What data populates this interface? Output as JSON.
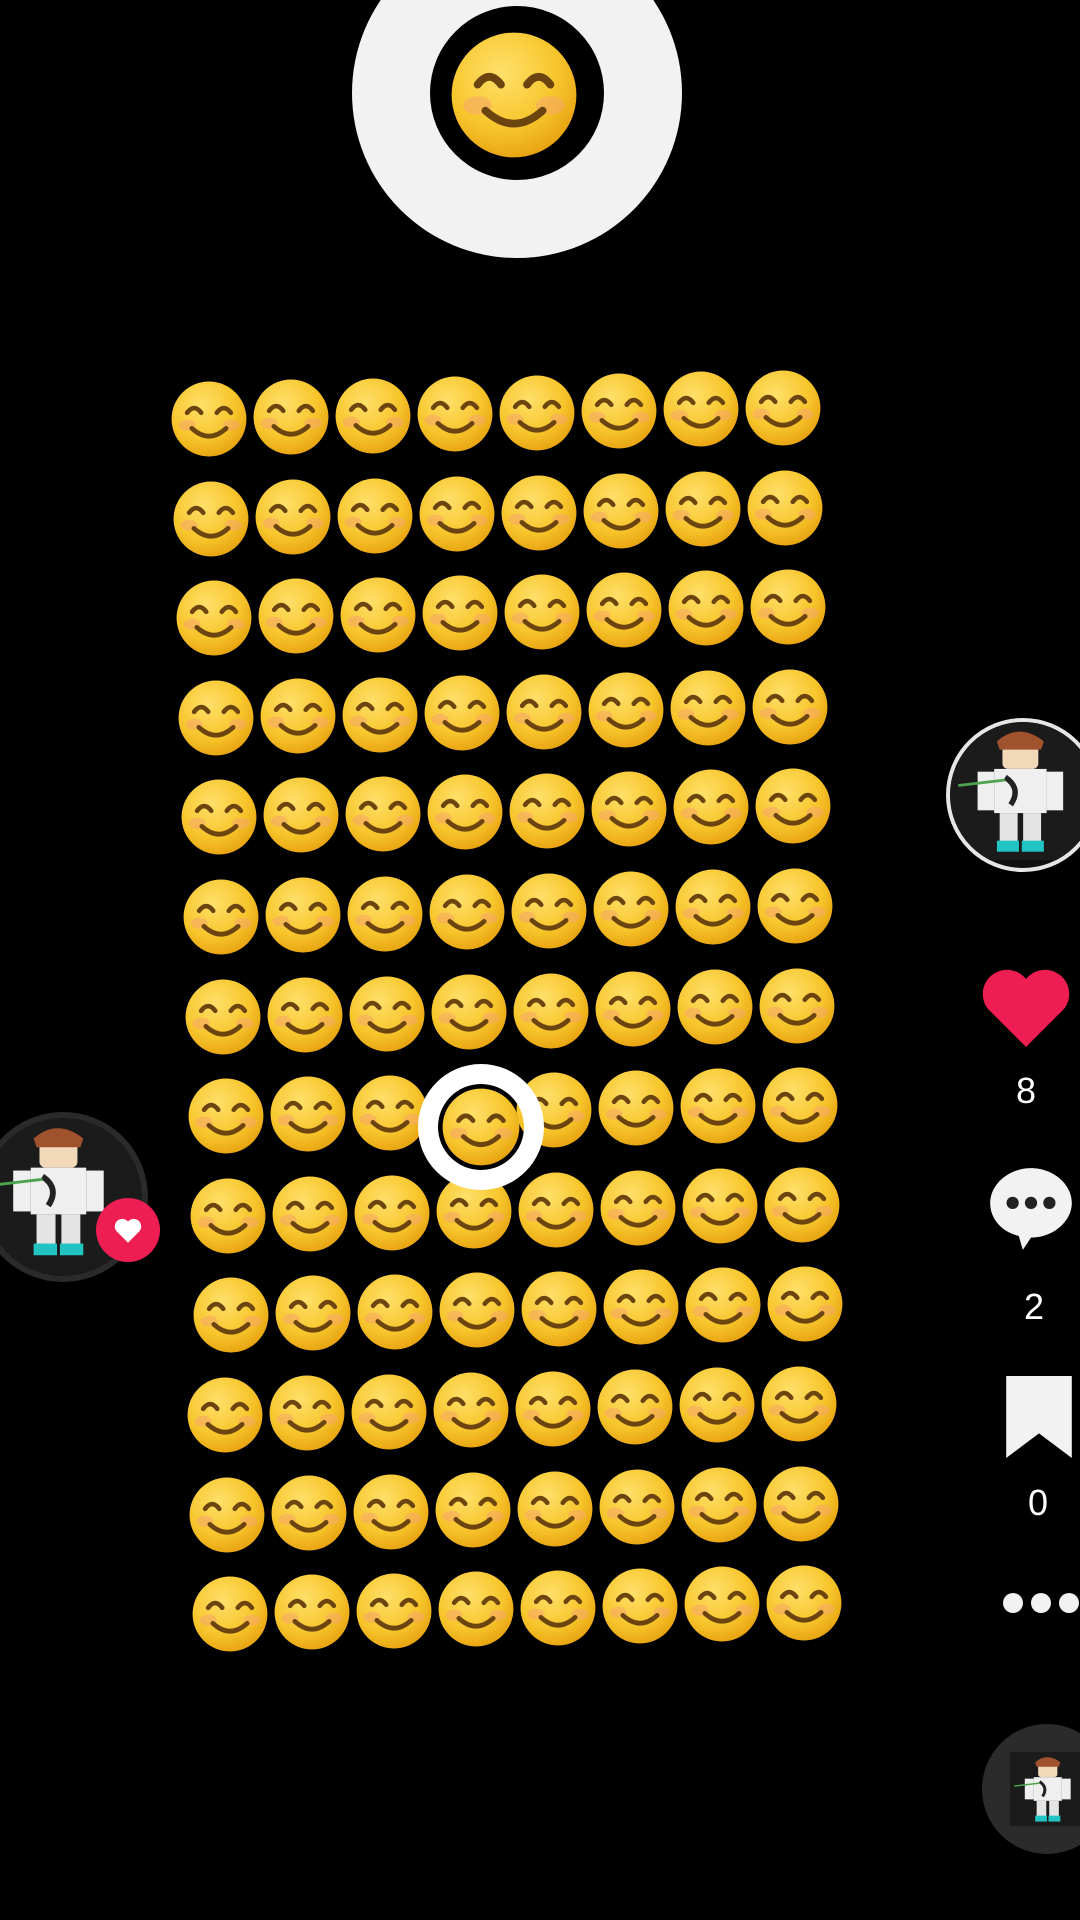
{
  "screen": {
    "background": "#000000",
    "emoji_grid": {
      "rows": 13,
      "columns": 8,
      "emoji": "smiling-face-with-smiling-eyes",
      "highlighted_cell": {
        "row": 8,
        "column": 4
      }
    }
  },
  "creator": {
    "avatar": "roblox-character-avatar",
    "follow_badge_icon": "heart-icon"
  },
  "actions": {
    "like": {
      "icon": "heart-icon",
      "color": "#ee1d52",
      "count": "8"
    },
    "comment": {
      "icon": "comment-icon",
      "count": "2"
    },
    "save": {
      "icon": "bookmark-icon",
      "count": "0"
    },
    "more": {
      "icon": "more-icon"
    }
  },
  "music": {
    "icon": "music-disc"
  },
  "colors": {
    "emoji_fill": "#f6c62b",
    "ring": "#ffffff",
    "like": "#ee1d52"
  }
}
